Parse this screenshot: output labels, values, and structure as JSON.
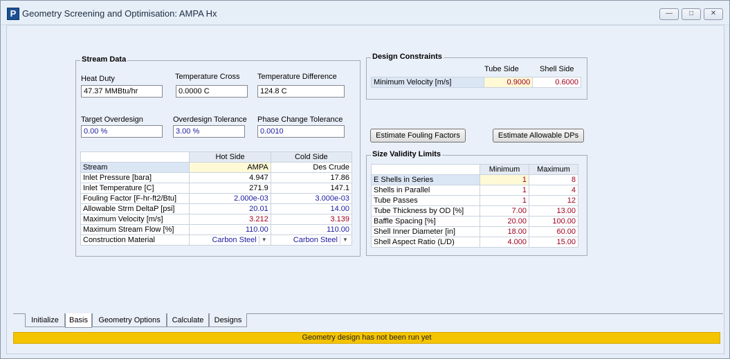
{
  "window": {
    "title": "Geometry Screening and Optimisation: AMPA Hx",
    "app_icon_letter": "P",
    "controls": {
      "minimize": "—",
      "maximize": "□",
      "close": "✕"
    }
  },
  "stream_data": {
    "legend": "Stream Data",
    "heat_duty": {
      "label": "Heat Duty",
      "value": "47.37 MMBtu/hr"
    },
    "temperature_cross": {
      "label": "Temperature Cross",
      "value": "0.0000 C"
    },
    "temperature_difference": {
      "label": "Temperature Difference",
      "value": "124.8 C"
    },
    "target_overdesign": {
      "label": "Target Overdesign",
      "value": "0.00 %"
    },
    "overdesign_tolerance": {
      "label": "Overdesign Tolerance",
      "value": "3.00 %"
    },
    "phase_change_tolerance": {
      "label": "Phase Change Tolerance",
      "value": "0.0010"
    },
    "table": {
      "headers": [
        "",
        "Hot Side",
        "Cold Side"
      ],
      "rows": [
        {
          "label": "Stream",
          "hot": "AMPA",
          "cold": "Des Crude"
        },
        {
          "label": "Inlet Pressure [bara]",
          "hot": "4.947",
          "cold": "17.86"
        },
        {
          "label": "Inlet Temperature [C]",
          "hot": "271.9",
          "cold": "147.1"
        },
        {
          "label": "Fouling Factor [F-hr-ft2/Btu]",
          "hot": "2.000e-03",
          "cold": "3.000e-03"
        },
        {
          "label": "Allowable Strm DeltaP [psi]",
          "hot": "20.01",
          "cold": "14.00"
        },
        {
          "label": "Maximum Velocity [m/s]",
          "hot": "3.212",
          "cold": "3.139"
        },
        {
          "label": "Maximum Stream Flow [%]",
          "hot": "110.00",
          "cold": "110.00"
        },
        {
          "label": "Construction Material",
          "hot": "Carbon Steel",
          "cold": "Carbon Steel"
        }
      ]
    }
  },
  "design_constraints": {
    "legend": "Design Constraints",
    "headers": [
      "Tube Side",
      "Shell Side"
    ],
    "row_label": "Minimum Velocity [m/s]",
    "tube_value": "0.9000",
    "shell_value": "0.6000"
  },
  "buttons": {
    "estimate_fouling": "Estimate Fouling Factors",
    "estimate_dps": "Estimate Allowable DPs"
  },
  "size_validity": {
    "legend": "Size Validity Limits",
    "headers": [
      "",
      "Minimum",
      "Maximum"
    ],
    "rows": [
      {
        "label": "E Shells in Series",
        "min": "1",
        "max": "8"
      },
      {
        "label": "Shells in Parallel",
        "min": "1",
        "max": "4"
      },
      {
        "label": "Tube Passes",
        "min": "1",
        "max": "12"
      },
      {
        "label": "Tube Thickness by OD [%]",
        "min": "7.00",
        "max": "13.00"
      },
      {
        "label": "Baffle Spacing [%]",
        "min": "20.00",
        "max": "100.00"
      },
      {
        "label": "Shell Inner Diameter [in]",
        "min": "18.00",
        "max": "60.00"
      },
      {
        "label": "Shell Aspect Ratio (L/D)",
        "min": "4.000",
        "max": "15.00"
      }
    ]
  },
  "tabs": [
    {
      "label": "Initialize",
      "active": false
    },
    {
      "label": "Basis",
      "active": true
    },
    {
      "label": "Geometry Options",
      "active": false
    },
    {
      "label": "Calculate",
      "active": false
    },
    {
      "label": "Designs",
      "active": false
    }
  ],
  "status": {
    "message": "Geometry design has not been run yet",
    "color": "#f5c400"
  }
}
